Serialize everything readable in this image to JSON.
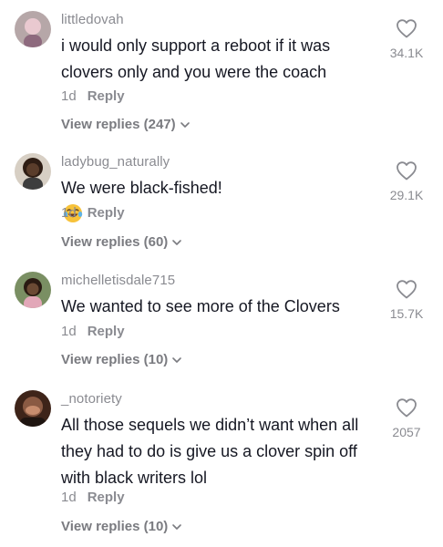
{
  "comments": [
    {
      "username": "littledovah",
      "text": "i would only support a reboot if it was\nclovers only and you were the coach",
      "age": "1d",
      "reply_label": "Reply",
      "view_replies": "View replies (247)",
      "likes": "34.1K",
      "avatar_colors": [
        "#b6a7a8",
        "#e9c9d0"
      ]
    },
    {
      "username": "ladybug_naturally",
      "text": "We were black-fished!",
      "emoji": "face-with-tears-of-joy",
      "age": "1d",
      "reply_label": "Reply",
      "view_replies": "View replies (60)",
      "likes": "29.1K",
      "avatar_colors": [
        "#d7cfc4",
        "#5a3d2b"
      ]
    },
    {
      "username": "michelletisdale715",
      "text": "We wanted to see more of the Clovers",
      "age": "1d",
      "reply_label": "Reply",
      "view_replies": "View replies (10)",
      "likes": "15.7K",
      "avatar_colors": [
        "#7a8f63",
        "#6b4a34"
      ]
    },
    {
      "username": "_notoriety",
      "text": "All those sequels we didn’t want when all\nthey had to do is give us a clover spin off\nwith black writers lol",
      "age": "1d",
      "reply_label": "Reply",
      "view_replies": "View replies (10)",
      "likes": "2057",
      "avatar_colors": [
        "#8a5a43",
        "#3e2419"
      ]
    }
  ],
  "colors": {
    "text_primary": "#161823",
    "text_secondary": "#8a8b91",
    "background": "#ffffff"
  }
}
